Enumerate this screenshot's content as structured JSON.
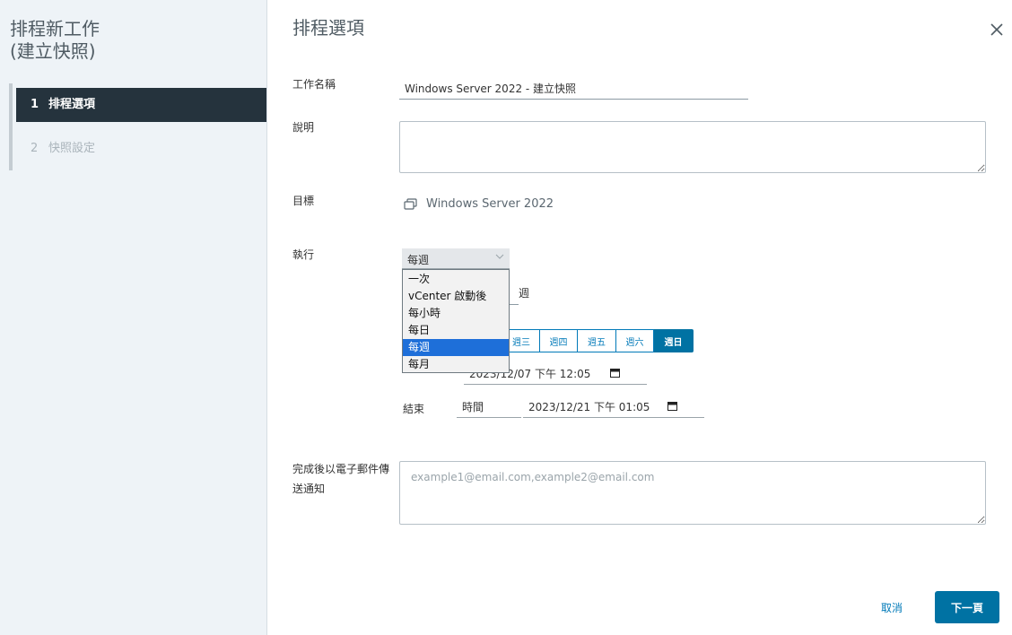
{
  "nav": {
    "title_line1": "排程新工作",
    "title_line2": "(建立快照)",
    "steps": [
      {
        "num": "1",
        "label": "排程選項"
      },
      {
        "num": "2",
        "label": "快照設定"
      }
    ]
  },
  "main": {
    "title": "排程選項",
    "close_icon": "close-icon"
  },
  "form": {
    "task_name_label": "工作名稱",
    "task_name_value": "Windows Server 2022 - 建立快照",
    "description_label": "說明",
    "description_value": "",
    "target_label": "目標",
    "target_icon": "vm-icon",
    "target_value": "Windows Server 2022",
    "run_label": "執行",
    "run_selected": "每週",
    "run_options": [
      "一次",
      "vCenter 啟動後",
      "每小時",
      "每日",
      "每週",
      "每月"
    ],
    "week_suffix": "週",
    "days": [
      "週三",
      "週四",
      "週五",
      "週六",
      "週日"
    ],
    "selected_day": "週日",
    "start_value": "2023/12/07 下午 12:05",
    "end_label": "結束",
    "end_type": "時間",
    "end_value": "2023/12/21 下午 01:05",
    "email_label": "完成後以電子郵件傳送通知",
    "email_placeholder": "example1@email.com,example2@email.com"
  },
  "footer": {
    "cancel_label": "取消",
    "next_label": "下一頁"
  },
  "colors": {
    "accent": "#0072a3",
    "nav_active": "#25333d",
    "dropdown_selected": "#1e6fd9"
  }
}
